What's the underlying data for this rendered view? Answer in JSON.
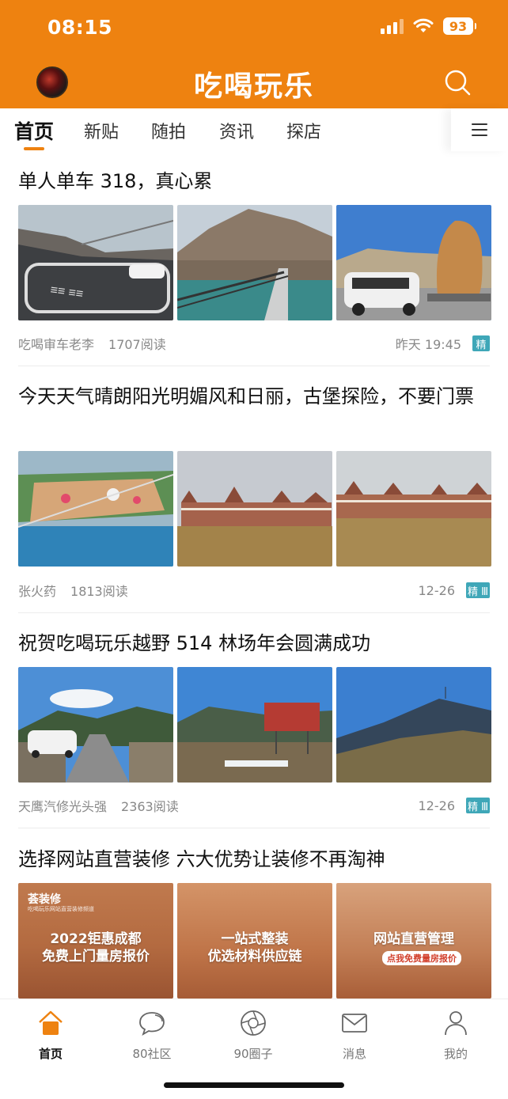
{
  "status_bar": {
    "time": "08:15",
    "battery": "93"
  },
  "header": {
    "app_title": "吃喝玩乐"
  },
  "tabs": [
    {
      "label": "首页",
      "active": true
    },
    {
      "label": "新贴",
      "active": false
    },
    {
      "label": "随拍",
      "active": false
    },
    {
      "label": "资讯",
      "active": false
    },
    {
      "label": "探店",
      "active": false
    }
  ],
  "articles": [
    {
      "title": "单人单车 318，真心累",
      "author": "吃喝审车老李",
      "reads": "1707阅读",
      "time": "昨天 19:45",
      "badge": "精"
    },
    {
      "title": "今天天气晴朗阳光明媚风和日丽，古堡探险，不要门票",
      "author": "张火药",
      "reads": "1813阅读",
      "time": "12-26",
      "badge": "精 Ⅲ"
    },
    {
      "title": "祝贺吃喝玩乐越野 514 林场年会圆满成功",
      "author": "天鹰汽修光头强",
      "reads": "2363阅读",
      "time": "12-26",
      "badge": "精 Ⅲ"
    },
    {
      "title": "选择网站直营装修 六大优势让装修不再淘神"
    }
  ],
  "ad_images": {
    "logo": "荟装修",
    "logo_sub": "吃喝玩乐网站直营装修频道",
    "panel1": [
      "2022钜惠成都",
      "免费上门量房报价"
    ],
    "panel2": [
      "一站式整装",
      "优选材料供应链"
    ],
    "panel3": "网站直营管理",
    "panel3_pill": "点我免费量房报价"
  },
  "bottom_nav": [
    {
      "label": "首页",
      "icon": "home-icon",
      "active": true
    },
    {
      "label": "80社区",
      "icon": "chat-bubble-icon",
      "active": false
    },
    {
      "label": "90圈子",
      "icon": "aperture-icon",
      "active": false
    },
    {
      "label": "消息",
      "icon": "envelope-icon",
      "active": false
    },
    {
      "label": "我的",
      "icon": "person-icon",
      "active": false
    }
  ],
  "colors": {
    "brand": "#ee8210",
    "badge": "#3fa7b8"
  }
}
